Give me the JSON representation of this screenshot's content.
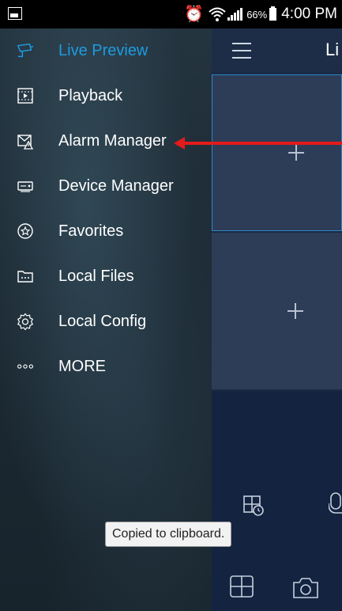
{
  "status_bar": {
    "battery_percent": "66%",
    "time": "4:00 PM",
    "icons": [
      "image-notification-icon",
      "alarm-clock-icon",
      "wifi-icon",
      "signal-icon",
      "battery-icon"
    ]
  },
  "drawer": {
    "items": [
      {
        "label": "Live Preview",
        "icon": "camera-icon",
        "active": true
      },
      {
        "label": "Playback",
        "icon": "playback-icon"
      },
      {
        "label": "Alarm Manager",
        "icon": "alarm-envelope-icon"
      },
      {
        "label": "Device Manager",
        "icon": "device-icon"
      },
      {
        "label": "Favorites",
        "icon": "star-icon"
      },
      {
        "label": "Local Files",
        "icon": "folder-icon"
      },
      {
        "label": "Local Config",
        "icon": "settings-icon"
      },
      {
        "label": "MORE",
        "icon": "more-icon"
      }
    ]
  },
  "main": {
    "header_title": "Li",
    "panes": [
      "add-channel",
      "add-channel"
    ]
  },
  "toast": {
    "text": "Copied to clipboard."
  },
  "colors": {
    "active": "#1e9be0",
    "arrow": "#e31b1b",
    "drawer_bg": "#1d2a34",
    "main_bg": "#1a2a44"
  }
}
